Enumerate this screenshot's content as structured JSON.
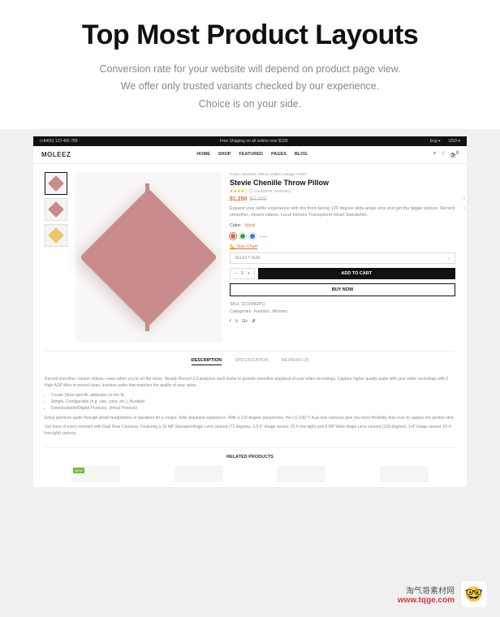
{
  "hero": {
    "title": "Top Most Product Layouts",
    "line1": "Conversion rate for your website will depend on product page view.",
    "line2": "We offer only trusted variants checked by our experience.",
    "line3": "Choice is on your side."
  },
  "topbar": {
    "phone": "(+8400) 123 456 789",
    "promo": "Free Shipping on all orders over $100",
    "lang": "Eng",
    "currency": "USD"
  },
  "header": {
    "logo": "MOLEEZ",
    "nav": [
      "HOME",
      "SHOP",
      "FEATURED",
      "PAGES",
      "BLOG"
    ],
    "cart_count": "0"
  },
  "product": {
    "breadcrumb": "Home  /  Bracelet  /  Black Leather Vintage Armlet",
    "title": "Stevie Chenille Throw Pillow",
    "rating_stars": "★★★★☆",
    "rating_text": "(2 customer reviews)",
    "price": "$1,250",
    "price_old": "$2,000",
    "short_desc": "Expand your selfie experience with the front-facing 120 degree wide-angle lens and get the bigger picture. Record smoother, clearer videos. Local Heroes Transparent Heart Sweatshirt.",
    "color_label": "Color:",
    "color_value": "Wool",
    "swatches": [
      "#d86b3c",
      "#2aa34a",
      "#2d7fd8"
    ],
    "size_chart": "Size Chart",
    "select_size": "SELECT SIZE",
    "qty": "1",
    "add_to_cart": "ADD TO CART",
    "buy_now": "BUY NOW",
    "sku_label": "SKU:",
    "sku": "3210483PU",
    "cat_label": "Categories:",
    "cats": "Fashion, Women",
    "social_icons": [
      "facebook",
      "twitter",
      "google-plus",
      "pinterest"
    ]
  },
  "tabs": [
    "DESCRIPTION",
    "SPECIFICATION",
    "REVIEWS (2)"
  ],
  "description": {
    "p1": "Record smoother, clearer videos—even when you're on the move. Steady Record 2.0 analyzes each frame to provide smoother playback of your video recordings. Capture higher quality audio with your video recordings with 2 High AOP Mics to record clean, lossless audio that matches the quality of your video.",
    "li1": "Create Store-specific attributes on the fly",
    "li2": "Simple, Configurable (e.g. size, color, etc.), Bundled",
    "li3": "Downloadable/Digital Products, Virtual Products",
    "p2": "Enjoy premium audio through wired headphones or speakers for a crisper, fuller playback experience. With a 120-degree perspective, the LG V30™ dual rear cameras give you more flexibility than ever to capture the perfect shot.",
    "p3": "Get more of every moment with Dual Rear Cameras. Featuring a 16 MP Standard-Angle Lens camera (71 degrees, 1/3.6″ image sensor, f/1.6 low-light) and 8 MP Wide-Angle Lens camera (120 degrees, 1/4″ image sensor, f/2.4 low-light) camera."
  },
  "related_title": "RELATED PRODUCTS",
  "related": {
    "badge1": "NEW"
  },
  "watermark": {
    "line1": "淘气哥素材网",
    "line2": "www.tqge.com",
    "emoji": "🤓"
  }
}
